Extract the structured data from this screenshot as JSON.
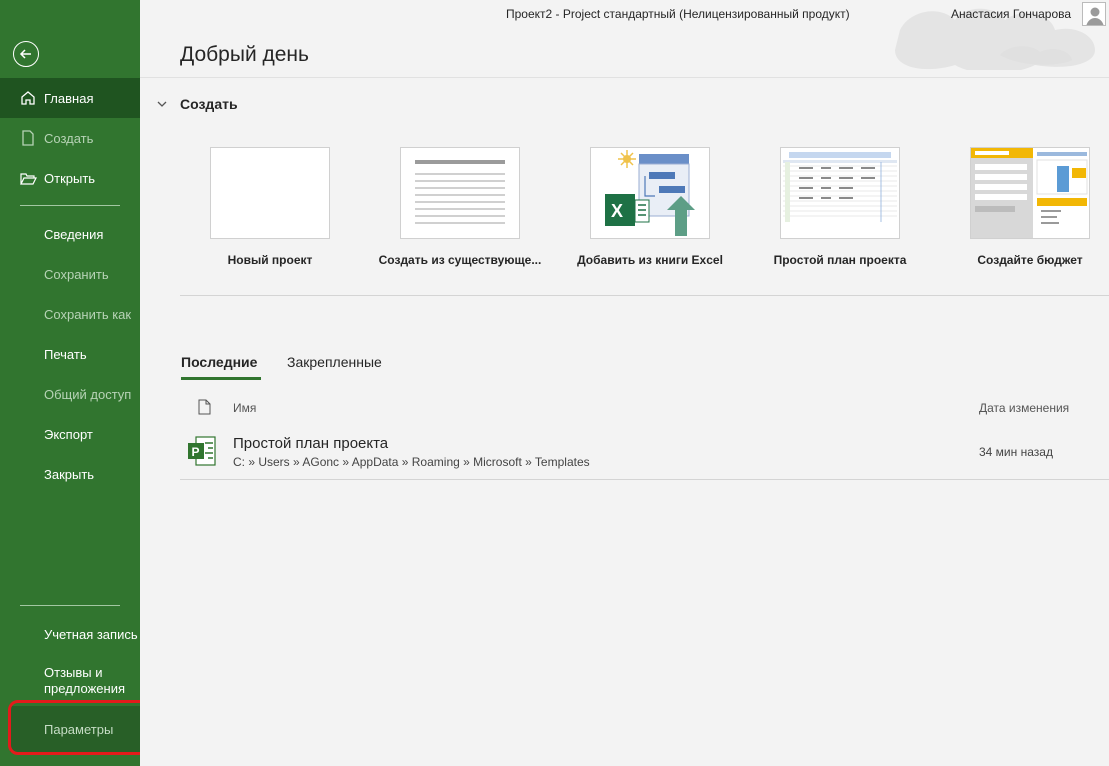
{
  "window": {
    "title": "Проект2  -  Project стандартный (Нелицензированный продукт)",
    "user": "Анастасия Гончарова"
  },
  "sidebar": {
    "back_icon": "arrow-left-circle-icon",
    "items": [
      {
        "label": "Главная",
        "icon": "home-icon",
        "state": "active"
      },
      {
        "label": "Создать",
        "icon": "new-file-icon",
        "state": "disabled"
      },
      {
        "label": "Открыть",
        "icon": "folder-open-icon",
        "state": "normal"
      },
      {
        "label": "Сведения",
        "state": "normal"
      },
      {
        "label": "Сохранить",
        "state": "disabled"
      },
      {
        "label": "Сохранить как",
        "state": "disabled"
      },
      {
        "label": "Печать",
        "state": "normal"
      },
      {
        "label": "Общий доступ",
        "state": "disabled"
      },
      {
        "label": "Экспорт",
        "state": "normal"
      },
      {
        "label": "Закрыть",
        "state": "normal"
      }
    ],
    "bottom_items": [
      {
        "label": "Учетная запись"
      },
      {
        "label": "Отзывы и предложения"
      },
      {
        "label": "Параметры"
      }
    ]
  },
  "main": {
    "greeting": "Добрый день",
    "create_section": {
      "title": "Создать",
      "templates": [
        {
          "label": "Новый проект"
        },
        {
          "label": "Создать из существующе..."
        },
        {
          "label": "Добавить из книги Excel"
        },
        {
          "label": "Простой план проекта"
        },
        {
          "label": "Создайте бюджет"
        }
      ]
    },
    "tabs": [
      {
        "label": "Последние",
        "active": true
      },
      {
        "label": "Закрепленные",
        "active": false
      }
    ],
    "columns": {
      "name": "Имя",
      "date": "Дата изменения"
    },
    "recent_files": [
      {
        "name": "Простой план проекта",
        "path": "C: » Users » AGonc » AppData » Roaming » Microsoft » Templates",
        "date": "34 мин назад",
        "icon": "project-file-icon"
      }
    ]
  },
  "colors": {
    "sidebar": "#31752f",
    "sidebar_active": "#1f5420",
    "accent": "#31752f",
    "highlight_frame": "#e31b1b"
  }
}
